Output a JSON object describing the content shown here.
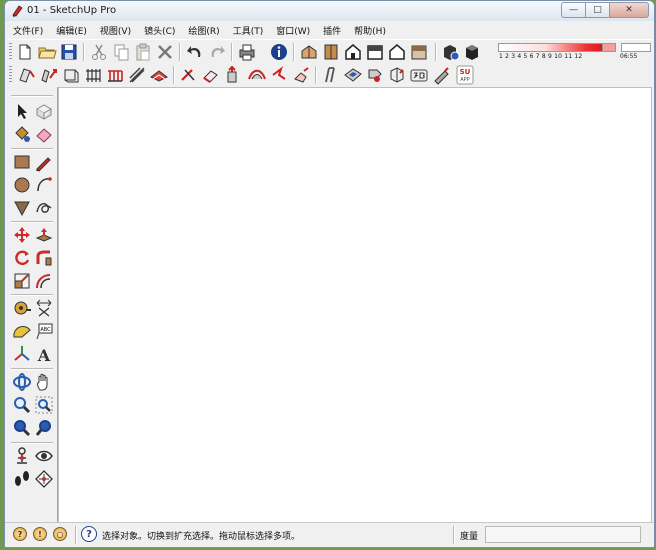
{
  "window": {
    "title": "01 - SketchUp Pro",
    "controls": {
      "minimize": "—",
      "maximize": "□",
      "close": "✕"
    }
  },
  "menu": [
    {
      "label": "文件(F)"
    },
    {
      "label": "编辑(E)"
    },
    {
      "label": "视图(V)"
    },
    {
      "label": "镜头(C)"
    },
    {
      "label": "绘图(R)"
    },
    {
      "label": "工具(T)"
    },
    {
      "label": "窗口(W)"
    },
    {
      "label": "插件"
    },
    {
      "label": "帮助(H)"
    }
  ],
  "shadow_settings": {
    "months": "1  2  3  4  5  6  7  8  9  10 11 12",
    "time": "06:55"
  },
  "status": {
    "hint": "选择对象。切换到扩充选择。拖动鼠标选择多项。",
    "measure_label": "度量",
    "measure_value": ""
  },
  "colors": {
    "accent_blue": "#1c3f8c",
    "accent_red": "#cc1d1d",
    "window_frame": "#7b8fa8"
  }
}
